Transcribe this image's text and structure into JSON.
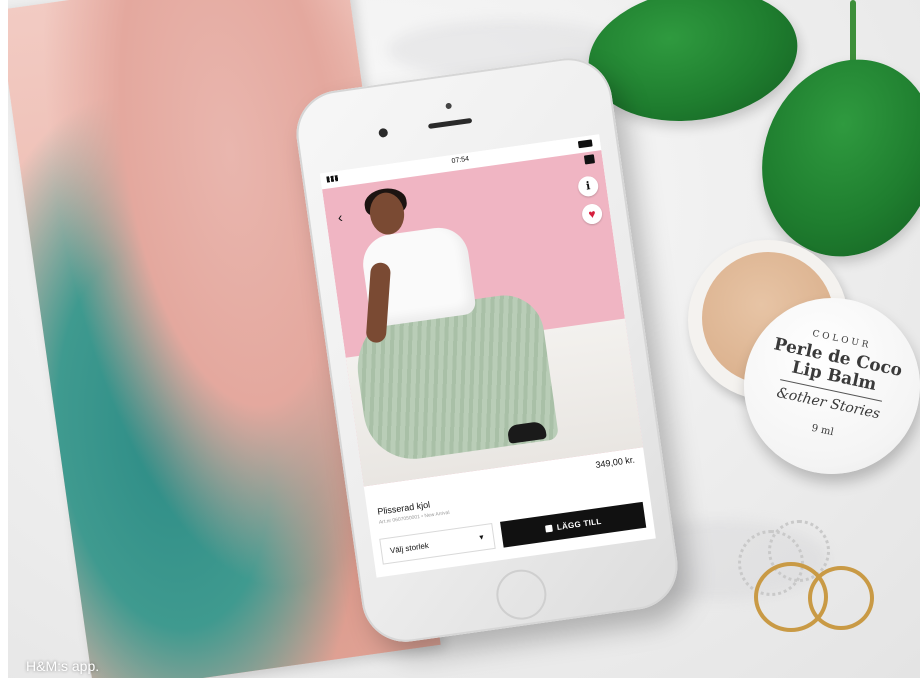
{
  "caption": "H&M:s app.",
  "phone_screen": {
    "status_time": "07:54",
    "price": "349,00 kr.",
    "product_title": "Plisserad kjol",
    "product_meta": "Art.nr 0607050001 • New Arrival",
    "size_select_label": "Välj storlek",
    "add_to_bag_label": "LÄGG TILL",
    "info_glyph": "i"
  },
  "lip_balm": {
    "lid_top": "COLOUR",
    "product_name": "Perle de Coco Lip Balm",
    "brand": "&other Stories",
    "size": "9 ml"
  },
  "colors": {
    "hero_pink": "#f0b5c3",
    "button_black": "#111111",
    "heart_red": "#d61f3d"
  }
}
